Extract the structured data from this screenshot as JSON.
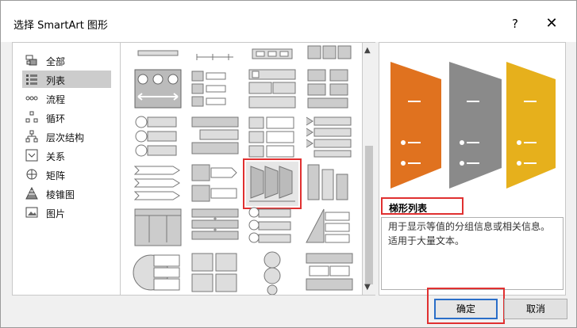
{
  "window": {
    "title": "选择 SmartArt 图形",
    "help_label": "?",
    "close_label": "✕"
  },
  "categories": [
    {
      "label": "全部",
      "icon": "all-icon"
    },
    {
      "label": "列表",
      "icon": "list-icon",
      "selected": true
    },
    {
      "label": "流程",
      "icon": "process-icon"
    },
    {
      "label": "循环",
      "icon": "cycle-icon"
    },
    {
      "label": "层次结构",
      "icon": "hierarchy-icon"
    },
    {
      "label": "关系",
      "icon": "relationship-icon"
    },
    {
      "label": "矩阵",
      "icon": "matrix-icon"
    },
    {
      "label": "棱锥图",
      "icon": "pyramid-icon"
    },
    {
      "label": "图片",
      "icon": "picture-icon"
    }
  ],
  "preview": {
    "title": "梯形列表",
    "description": "用于显示等值的分组信息或相关信息。适用于大量文本。",
    "colors": {
      "orange": "#e0721f",
      "gray": "#8a8a8a",
      "gold": "#e6b01c"
    }
  },
  "buttons": {
    "ok": "确定",
    "cancel": "取消"
  },
  "colors": {
    "highlight": "#e03030",
    "focus": "#2a6ec8"
  }
}
